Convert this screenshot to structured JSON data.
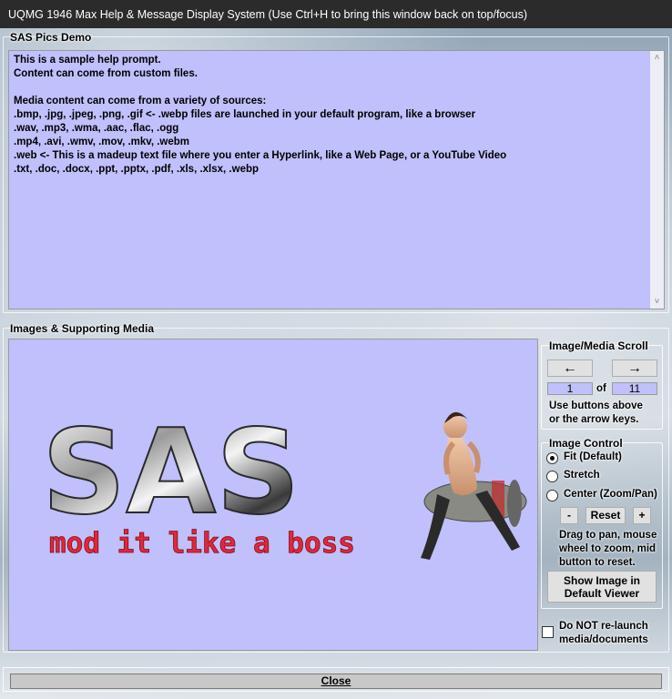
{
  "window": {
    "title": "UQMG 1946 Max Help & Message Display System (Use Ctrl+H to bring this window back on top/focus)"
  },
  "help": {
    "group_title": "SAS Pics Demo",
    "lines": [
      "This is a sample help prompt.",
      "Content can come from custom files.",
      "",
      "Media content can come from a variety of sources:",
      ".bmp, .jpg, .jpeg, .png, .gif <- .webp files are launched in your default program, like a browser",
      ".wav, .mp3, .wma, .aac, .flac, .ogg",
      ".mp4, .avi, .wmv, .mov, .mkv, .webm",
      ".web <- This is a madeup text file where you enter a Hyperlink, like a Web Page, or a YouTube Video",
      ".txt, .doc, .docx, .ppt, .pptx, .pdf, .xls, .xlsx, .webp"
    ]
  },
  "media": {
    "group_title": "Images & Supporting Media",
    "logo_text": "SAS",
    "tagline": "mod it like a boss"
  },
  "scroll": {
    "title": "Image/Media Scroll",
    "prev_label": "←",
    "next_label": "→",
    "current": "1",
    "of_label": "of",
    "total": "11",
    "hint_1": "Use buttons above",
    "hint_2": "or the arrow keys."
  },
  "control": {
    "title": "Image Control",
    "option_fit": "Fit (Default)",
    "option_stretch": "Stretch",
    "option_center": "Center (Zoom/Pan)",
    "minus_label": "-",
    "reset_label": "Reset",
    "plus_label": "+",
    "hint_1": "Drag to pan, mouse",
    "hint_2": "wheel to zoom, mid",
    "hint_3": "button to reset.",
    "show_image_1": "Show Image in",
    "show_image_2": "Default Viewer"
  },
  "relaunch": {
    "label_1": "Do NOT re-launch",
    "label_2": "media/documents"
  },
  "footer": {
    "close_label": "Close"
  },
  "colors": {
    "panel_bg": "#c0c0fc",
    "titlebar_bg": "#2b2b2b",
    "tagline_red": "#e0283a"
  }
}
